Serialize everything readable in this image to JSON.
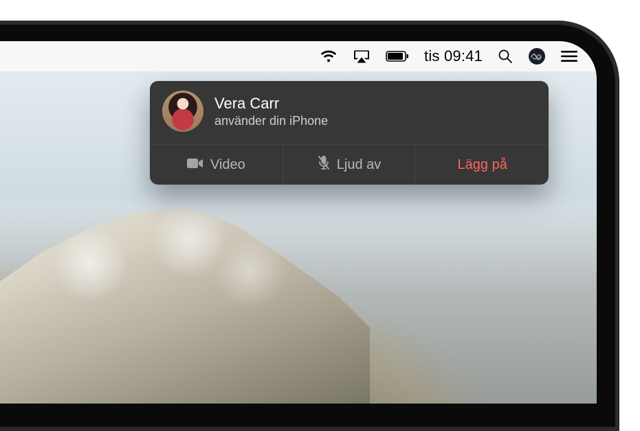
{
  "menubar": {
    "time_text": "tis 09:41",
    "icons": {
      "wifi": "wifi-icon",
      "airplay": "airplay-icon",
      "battery": "battery-icon",
      "spotlight": "spotlight-icon",
      "siri": "siri-icon",
      "notification_center": "notification-center-icon"
    }
  },
  "notification": {
    "caller_name": "Vera Carr",
    "subtitle": "använder din iPhone",
    "actions": {
      "video_label": "Video",
      "mute_label": "Ljud av",
      "hangup_label": "Lägg på"
    }
  }
}
